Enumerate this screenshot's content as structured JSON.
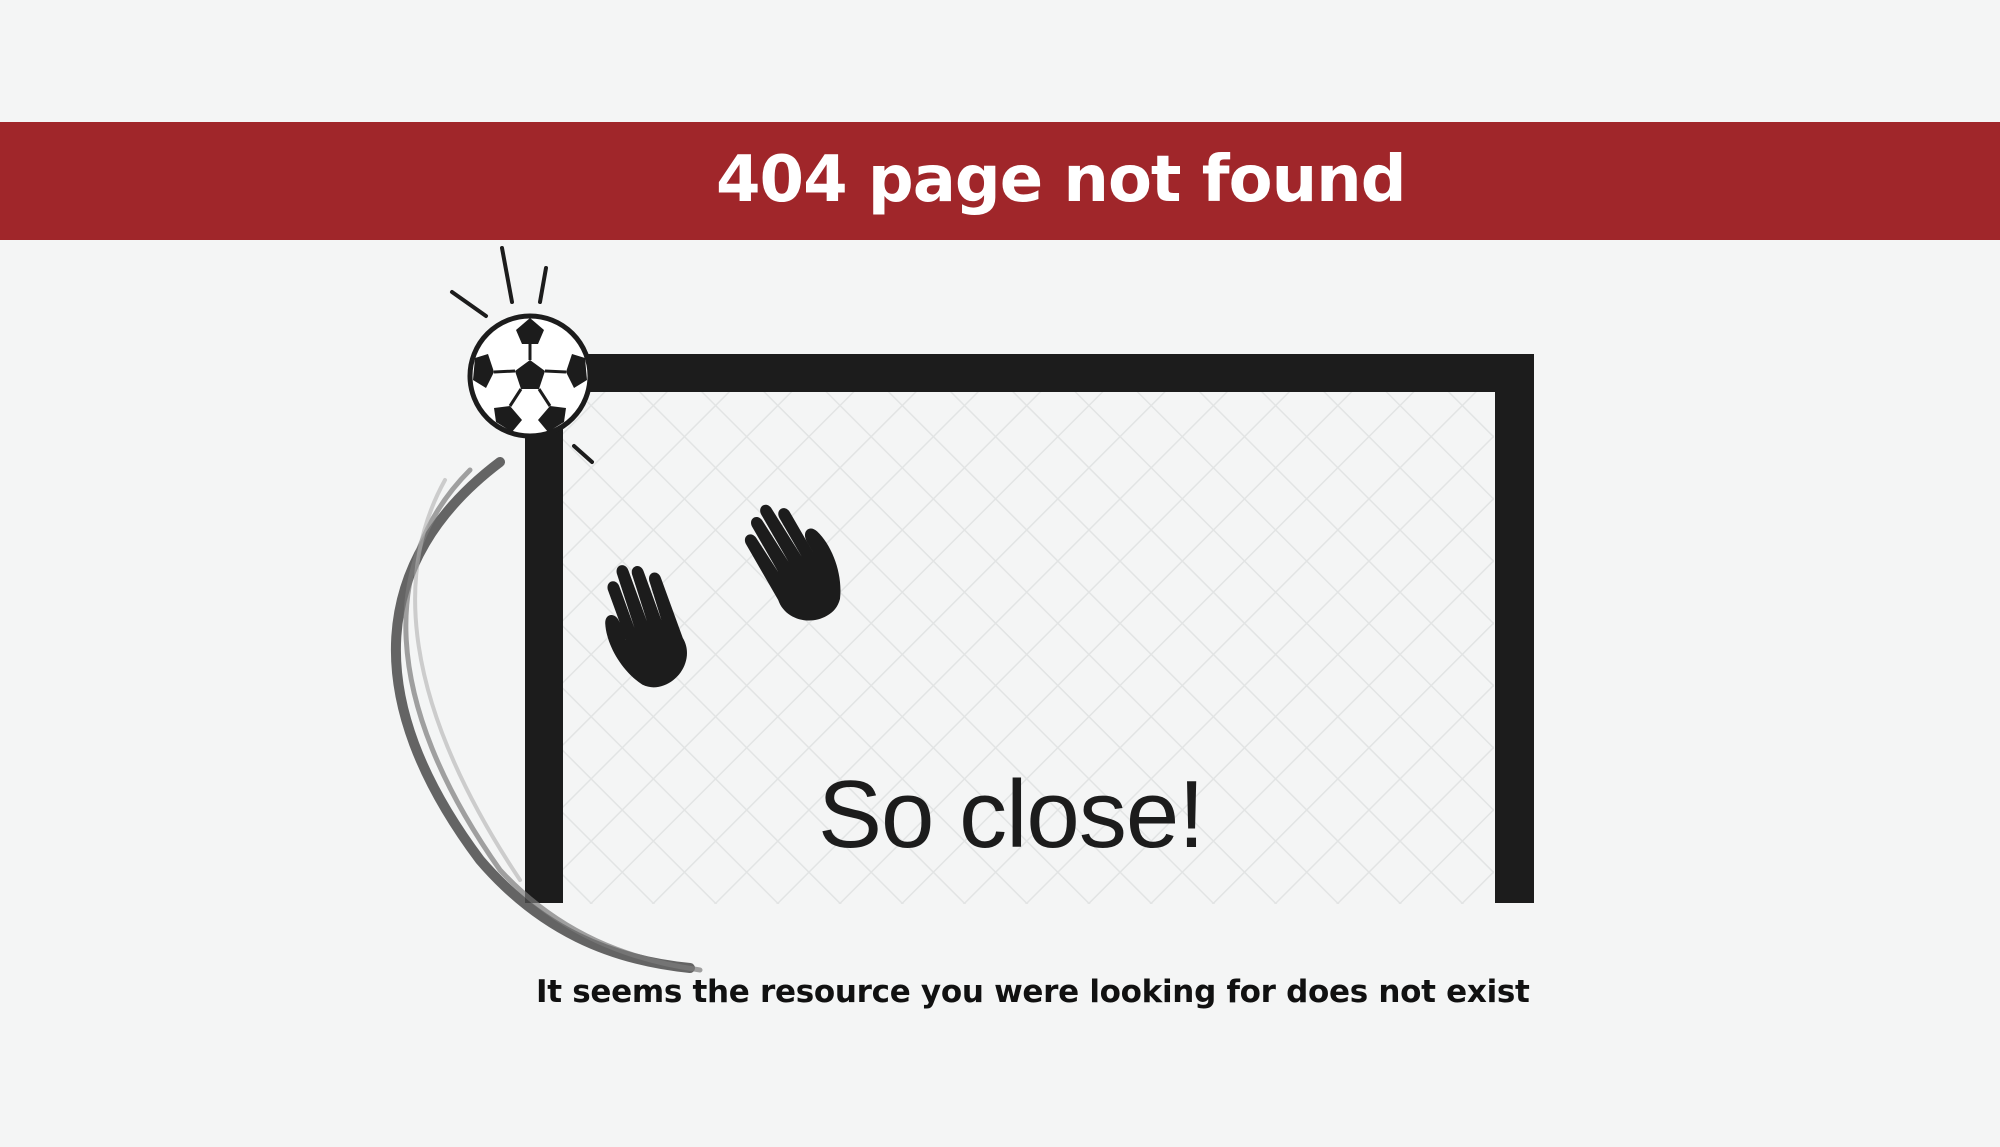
{
  "banner": {
    "title": "404 page not found",
    "background_color": "#a0262a",
    "text_color": "#ffffff"
  },
  "illustration": {
    "caption": "So close!",
    "icons": [
      "soccer-ball-icon",
      "goal-frame",
      "goal-net",
      "goalkeeper-left-glove-icon",
      "goalkeeper-right-glove-icon",
      "ball-motion-trail"
    ]
  },
  "message": {
    "text": "It seems the resource you were looking for does not exist"
  },
  "colors": {
    "page_background": "#f4f5f5",
    "goal_frame": "#1c1c1c"
  }
}
